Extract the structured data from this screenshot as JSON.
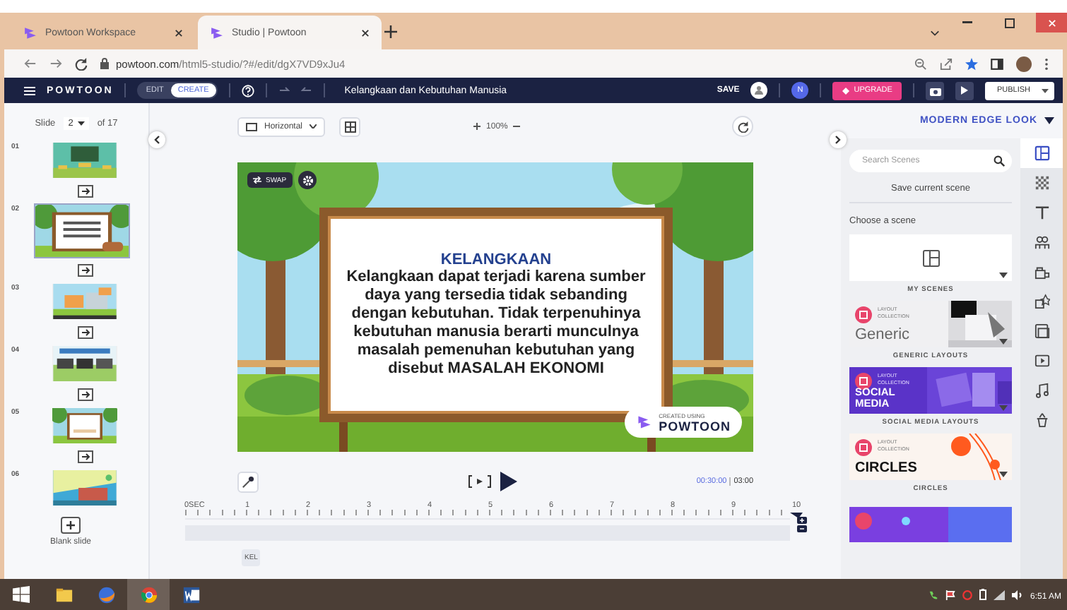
{
  "browser": {
    "tabs": [
      {
        "title": "Powtoon Workspace",
        "selected": false
      },
      {
        "title": "Studio | Powtoon",
        "selected": true
      }
    ],
    "url_domain": "powtoon.com",
    "url_path": "/html5-studio/?#/edit/dgX7VD9xJu4"
  },
  "app_bar": {
    "logo": "POWTOON",
    "modes": [
      {
        "label": "EDIT",
        "selected": false
      },
      {
        "label": "CREATE",
        "selected": true
      }
    ],
    "title": "Kelangkaan dan Kebutuhan Manusia",
    "save": "SAVE",
    "user_initial": "N",
    "upgrade": "UPGRADE",
    "publish": "PUBLISH"
  },
  "slides_panel": {
    "label": "Slide",
    "current": "2",
    "total": "of 17",
    "slides": [
      {
        "number": "01",
        "selected": false
      },
      {
        "number": "02",
        "selected": true
      },
      {
        "number": "03",
        "selected": false
      },
      {
        "number": "04",
        "selected": false
      },
      {
        "number": "05",
        "selected": false
      },
      {
        "number": "06",
        "selected": false
      }
    ],
    "blank_slide": "Blank slide"
  },
  "canvas": {
    "orientation": "Horizontal",
    "zoom": "100%",
    "swap": "SWAP",
    "heading": "KELANGKAAN",
    "body": "Kelangkaan dapat terjadi karena sumber daya yang tersedia tidak sebanding dengan kebutuhan. Tidak terpenuhinya kebutuhan manusia berarti munculnya masalah pemenuhan kebutuhan yang disebut MASALAH EKONOMI",
    "badge_small": "CREATED USING",
    "badge_brand": "POWTOON"
  },
  "timeline": {
    "time_current": "00:30:00",
    "time_total": "03:00",
    "ticks": [
      "0SEC",
      "1",
      "2",
      "3",
      "4",
      "5",
      "6",
      "7",
      "8",
      "9",
      "10"
    ],
    "layer": "KEL"
  },
  "scenes_panel": {
    "style": "MODERN EDGE LOOK",
    "search_placeholder": "Search Scenes",
    "save_scene": "Save current scene",
    "choose": "Choose a scene",
    "cards": [
      {
        "kind": "my",
        "label": "MY SCENES"
      },
      {
        "kind": "generic",
        "tag": "LAYOUT COLLECTION",
        "title": "Generic",
        "label": "GENERIC LAYOUTS"
      },
      {
        "kind": "social",
        "tag": "LAYOUT COLLECTION",
        "title": "SOCIAL MEDIA",
        "label": "SOCIAL MEDIA LAYOUTS"
      },
      {
        "kind": "circles",
        "tag": "LAYOUT COLLECTION",
        "title": "CIRCLES",
        "label": "CIRCLES"
      },
      {
        "kind": "partial"
      }
    ]
  },
  "rail": {
    "items": [
      {
        "selected": true
      },
      {
        "selected": false
      },
      {
        "selected": false
      },
      {
        "selected": false
      },
      {
        "selected": false
      },
      {
        "selected": false
      },
      {
        "selected": false
      },
      {
        "selected": false
      },
      {
        "selected": false
      },
      {
        "selected": false
      }
    ]
  },
  "taskbar": {
    "time": "6:51 AM"
  }
}
